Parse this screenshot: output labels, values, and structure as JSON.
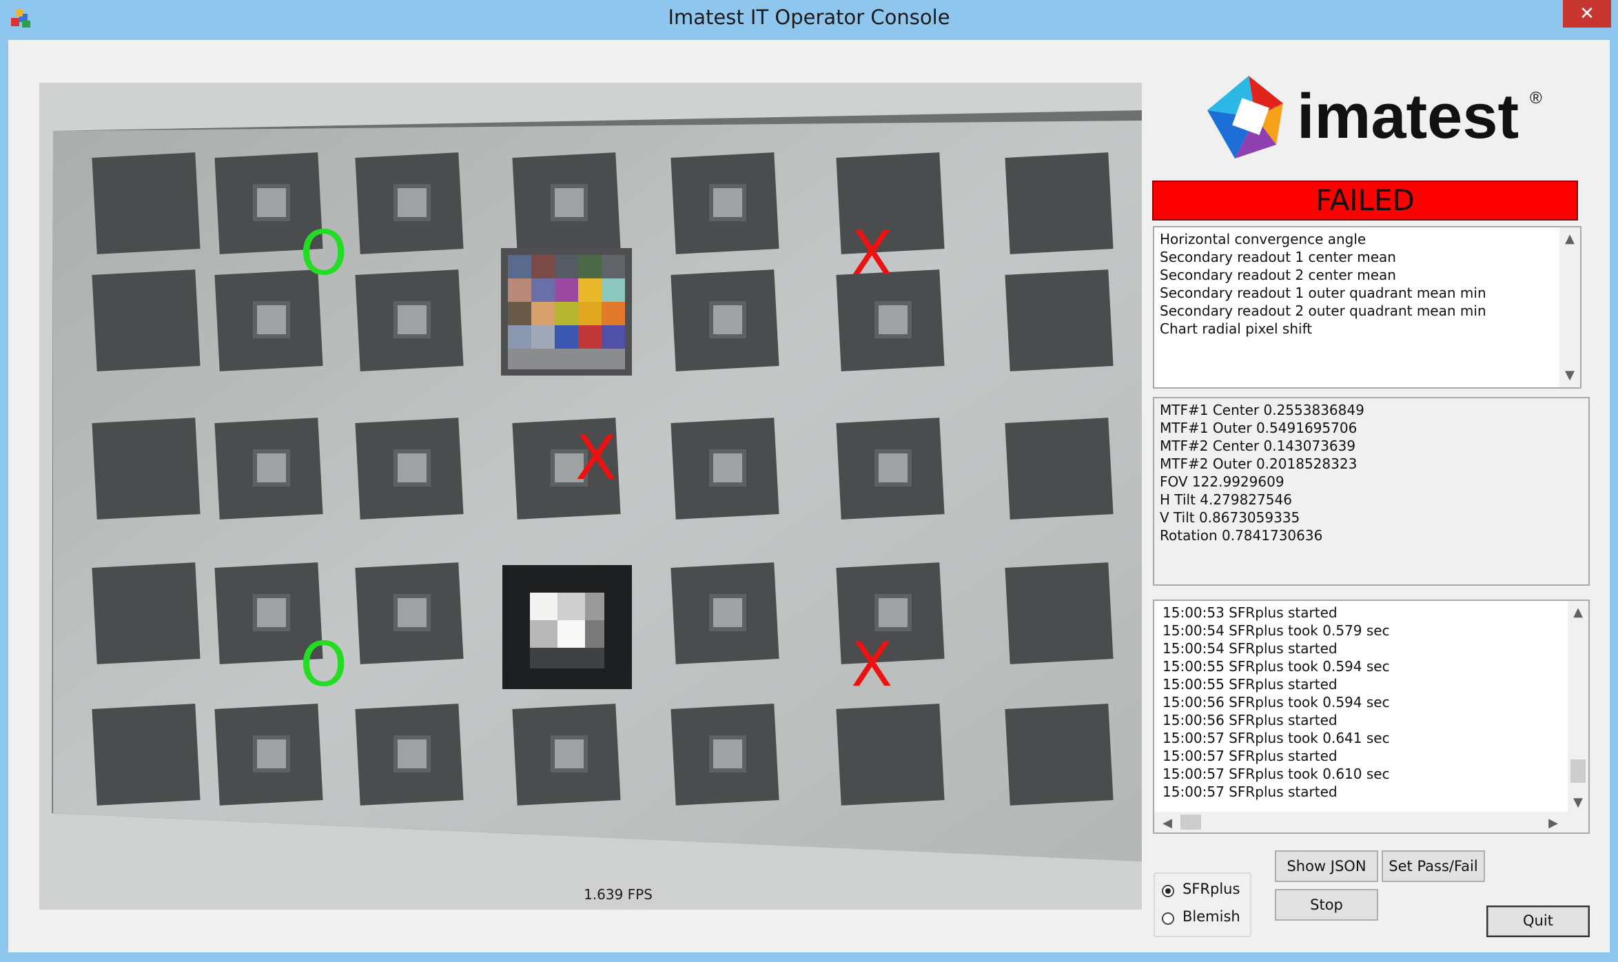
{
  "window": {
    "title": "Imatest IT Operator Console",
    "close_glyph": "✕"
  },
  "camera": {
    "fps_label": "1.639 FPS",
    "markers": [
      "O",
      "X",
      "X",
      "O",
      "X"
    ],
    "marker_colors": {
      "pass": "#22dd22",
      "fail": "#ee1111"
    }
  },
  "logo": {
    "text": "imatest",
    "registered": "®"
  },
  "status": {
    "text": "FAILED",
    "color": "#fe0000"
  },
  "fail_list": [
    "Horizontal convergence angle",
    "Secondary readout 1 center mean",
    "Secondary readout 2 center mean",
    "Secondary readout 1 outer quadrant mean min",
    "Secondary readout 2 outer quadrant mean min",
    "Chart radial pixel shift"
  ],
  "metrics": [
    "MTF#1 Center 0.2553836849",
    "MTF#1 Outer 0.5491695706",
    "MTF#2 Center 0.143073639",
    "MTF#2 Outer 0.2018528323",
    "FOV 122.9929609",
    "H Tilt 4.279827546",
    "V Tilt 0.8673059335",
    "Rotation 0.7841730636"
  ],
  "log": [
    "15:00:53 SFRplus started",
    "15:00:54 SFRplus took 0.579 sec",
    "15:00:54 SFRplus started",
    "15:00:55 SFRplus took 0.594 sec",
    "15:00:55 SFRplus started",
    "15:00:56 SFRplus took 0.594 sec",
    "15:00:56 SFRplus started",
    "15:00:57 SFRplus took 0.641 sec",
    "15:00:57 SFRplus started",
    "15:00:57 SFRplus took 0.610 sec",
    "15:00:57 SFRplus started"
  ],
  "buttons": {
    "show_json": "Show JSON",
    "set_pass_fail": "Set Pass/Fail",
    "stop": "Stop",
    "quit": "Quit"
  },
  "mode": {
    "options": [
      "SFRplus",
      "Blemish"
    ],
    "selected": "SFRplus"
  },
  "icons": {
    "app": "app-icon",
    "close": "close-icon",
    "scroll_up": "chevron-up-icon",
    "scroll_down": "chevron-down-icon",
    "scroll_left": "chevron-left-icon",
    "scroll_right": "chevron-right-icon"
  }
}
